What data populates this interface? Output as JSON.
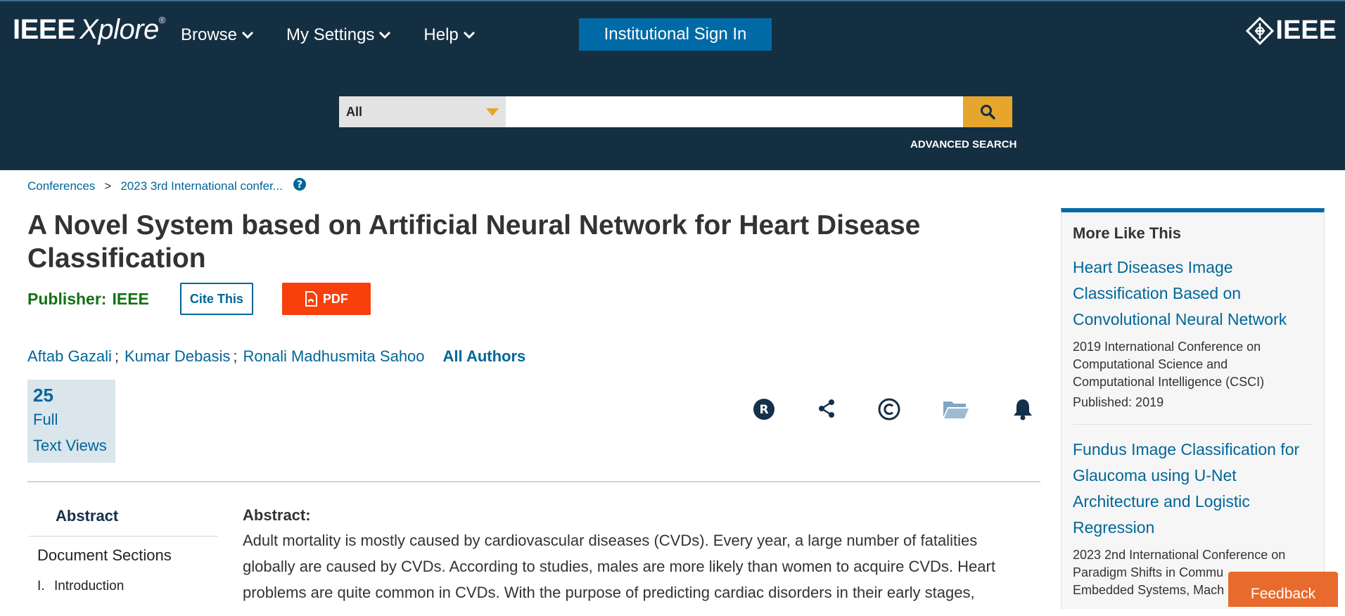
{
  "header": {
    "logo_bold": "IEEE",
    "logo_italic": "Xplore",
    "logo_mark": "®",
    "nav": [
      {
        "label": "Browse",
        "icon": "chevron-down-icon"
      },
      {
        "label": "My Settings",
        "icon": "chevron-down-icon"
      },
      {
        "label": "Help",
        "icon": "chevron-down-icon"
      }
    ],
    "signin_label": "Institutional Sign In",
    "brand": "IEEE",
    "colors": {
      "background": "#152f42",
      "signin": "#006aa6",
      "search_button": "#e6a52d"
    }
  },
  "search": {
    "scope": "All",
    "placeholder": "",
    "advanced_label": "ADVANCED SEARCH"
  },
  "breadcrumb": {
    "items": [
      "Conferences",
      "2023 3rd International confer..."
    ],
    "separator": ">",
    "help_icon": "question-circle-icon"
  },
  "article": {
    "title": "A Novel System based on Artificial Neural Network for Heart Disease Classification",
    "publisher_label": "Publisher:",
    "publisher": "IEEE",
    "cite_label": "Cite This",
    "pdf_label": "PDF",
    "authors": [
      "Aftab Gazali",
      "Kumar Debasis",
      "Ronali Madhusmita Sahoo"
    ],
    "author_separator": ";",
    "all_authors_label": "All Authors",
    "metric": {
      "value": "25",
      "label_line1": "Full",
      "label_line2": "Text Views"
    },
    "actions": [
      "rights-icon",
      "share-icon",
      "copyright-icon",
      "folder-icon",
      "bell-icon"
    ]
  },
  "leftnav": {
    "active_tab": "Abstract",
    "sections_heading": "Document Sections",
    "sections": [
      {
        "num": "I.",
        "label": "Introduction"
      }
    ]
  },
  "abstract": {
    "heading": "Abstract:",
    "lines": [
      "Adult mortality is mostly caused by cardiovascular diseases (CVDs). Every year, a large number of fatalities",
      "globally are caused by CVDs. According to studies, males are more likely than women to acquire CVDs. Heart",
      "problems are quite common in CVDs. With the purpose of predicting cardiac disorders in their early stages,"
    ]
  },
  "more_like_this": {
    "heading": "More Like This",
    "items": [
      {
        "title_lines": [
          "Heart Diseases Image",
          "Classification Based on",
          "Convolutional Neural Network"
        ],
        "venue_lines": [
          "2019 International Conference on",
          "Computational Science and",
          "Computational Intelligence (CSCI)"
        ],
        "published": "Published: 2019"
      },
      {
        "title_lines": [
          "Fundus Image Classification for",
          "Glaucoma using U-Net",
          "Architecture and Logistic",
          "Regression"
        ],
        "venue_lines": [
          "2023 2nd International Conference on",
          "Paradigm Shifts in Commu",
          "Embedded Systems, Mach"
        ]
      }
    ]
  },
  "feedback_label": "Feedback"
}
